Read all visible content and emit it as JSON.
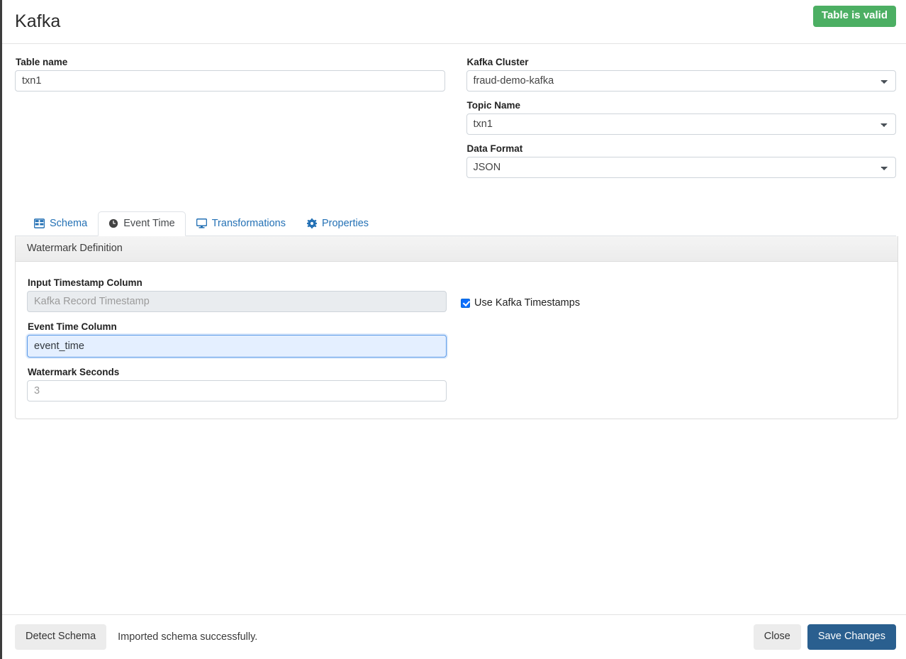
{
  "header": {
    "title": "Kafka",
    "status_badge": "Table is valid",
    "status_badge_color": "#4caf63"
  },
  "form": {
    "table_name": {
      "label": "Table name",
      "value": "txn1"
    },
    "kafka_cluster": {
      "label": "Kafka Cluster",
      "value": "fraud-demo-kafka",
      "options": [
        "fraud-demo-kafka"
      ]
    },
    "topic_name": {
      "label": "Topic Name",
      "value": "txn1",
      "options": [
        "txn1"
      ]
    },
    "data_format": {
      "label": "Data Format",
      "value": "JSON",
      "options": [
        "JSON"
      ]
    }
  },
  "tabs": [
    {
      "label": "Schema",
      "icon": "table-icon",
      "active": false
    },
    {
      "label": "Event Time",
      "icon": "clock-icon",
      "active": true
    },
    {
      "label": "Transformations",
      "icon": "monitor-icon",
      "active": false
    },
    {
      "label": "Properties",
      "icon": "gear-icon",
      "active": false
    }
  ],
  "watermark": {
    "panel_title": "Watermark Definition",
    "input_timestamp_column": {
      "label": "Input Timestamp Column",
      "value": "",
      "placeholder": "Kafka Record Timestamp",
      "disabled": true
    },
    "use_kafka_timestamps": {
      "label": "Use Kafka Timestamps",
      "checked": true
    },
    "event_time_column": {
      "label": "Event Time Column",
      "value": "event_time",
      "placeholder": ""
    },
    "watermark_seconds": {
      "label": "Watermark Seconds",
      "value": "",
      "placeholder": "3"
    }
  },
  "footer": {
    "detect_schema_label": "Detect Schema",
    "message": "Imported schema successfully.",
    "close_label": "Close",
    "save_label": "Save Changes"
  }
}
